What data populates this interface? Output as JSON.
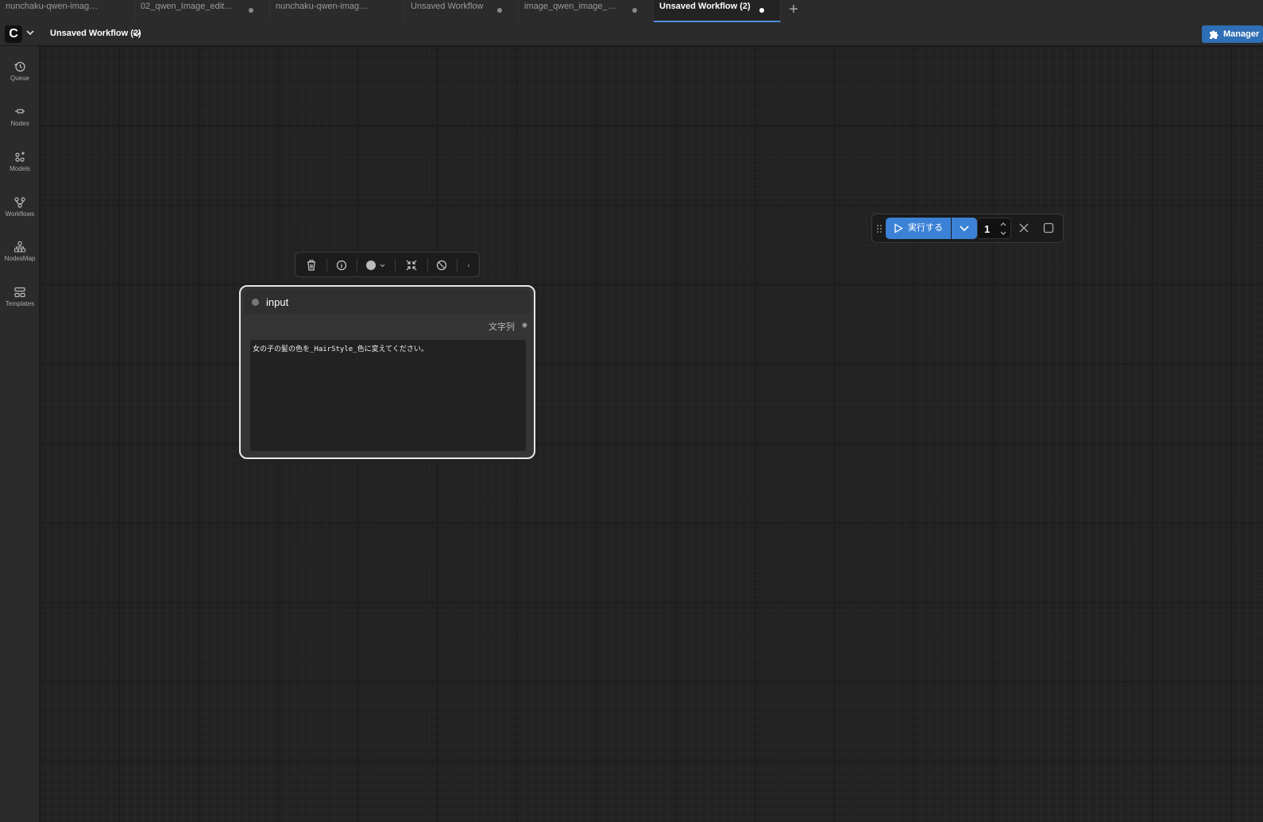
{
  "tabs": [
    {
      "label": "nunchaku-qwen-imag…",
      "modified": false
    },
    {
      "label": "02_qwen_Image_edit…",
      "modified": true
    },
    {
      "label": "nunchaku-qwen-imag…",
      "modified": false
    },
    {
      "label": "Unsaved Workflow",
      "modified": true
    },
    {
      "label": "image_qwen_image_…",
      "modified": true
    },
    {
      "label": "Unsaved Workflow (2)",
      "modified": true
    }
  ],
  "active_tab_index": 5,
  "topbar": {
    "workflow_title": "Unsaved Workflow (2)",
    "manager_label": "Manager"
  },
  "sidebar": {
    "items": [
      {
        "label": "Queue",
        "icon": "history-icon"
      },
      {
        "label": "Nodes",
        "icon": "nodes-icon"
      },
      {
        "label": "Models",
        "icon": "models-icon"
      },
      {
        "label": "Workflows",
        "icon": "workflows-icon"
      },
      {
        "label": "NodesMap",
        "icon": "nodesmap-icon"
      },
      {
        "label": "Templates",
        "icon": "templates-icon"
      }
    ]
  },
  "node": {
    "title": "input",
    "output_label": "文字列",
    "text_value": "女の子の髪の色を_HairStyle_色に変えてください。"
  },
  "runbar": {
    "run_label": "実行する",
    "batch_count": "1"
  },
  "colors": {
    "accent": "#3b82d6",
    "manager": "#2f6fb5",
    "background": "#202020"
  }
}
